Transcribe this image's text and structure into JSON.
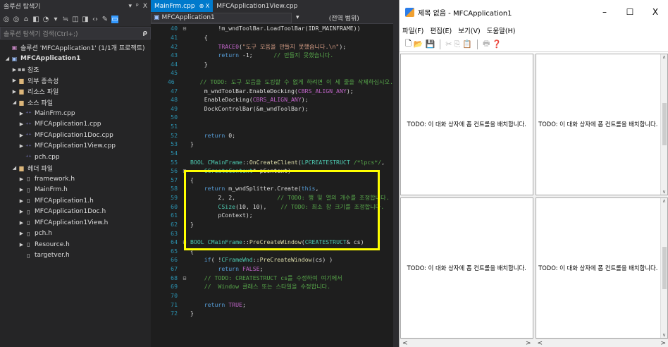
{
  "solution_explorer": {
    "title": "솔루션 탐색기",
    "title_ctrls": [
      "▾",
      "ᵖ",
      "X"
    ],
    "toolbar_icons": [
      "◎",
      "◎",
      "⌂",
      "◧",
      "◔",
      "▾",
      "≒",
      "◫",
      "◨",
      "‹›",
      "✎",
      "▭"
    ],
    "search_placeholder": "솔루션 탐색기 검색(Ctrl+;)",
    "search_icon": "ρ",
    "tree": [
      {
        "level": 0,
        "arrow": "",
        "icon": "▣",
        "icon_class": "ico-sol",
        "label": "솔루션 'MFCApplication1' (1/1개 프로젝트)",
        "bold": false
      },
      {
        "level": 0,
        "arrow": "◢",
        "icon": "▣",
        "icon_class": "ico-proj",
        "label": "MFCApplication1",
        "bold": true
      },
      {
        "level": 1,
        "arrow": "▶",
        "icon": "▪▪",
        "icon_class": "ico-ref",
        "label": "참조",
        "bold": false
      },
      {
        "level": 1,
        "arrow": "▶",
        "icon": "▆",
        "icon_class": "ico-folder",
        "label": "외부 종속성",
        "bold": false
      },
      {
        "level": 1,
        "arrow": "▶",
        "icon": "▆",
        "icon_class": "ico-folder",
        "label": "리소스 파일",
        "bold": false
      },
      {
        "level": 1,
        "arrow": "◢",
        "icon": "▆",
        "icon_class": "ico-folder",
        "label": "소스 파일",
        "bold": false
      },
      {
        "level": 2,
        "arrow": "▶",
        "icon": "⁺⁺",
        "icon_class": "ico-cpp",
        "label": "MainFrm.cpp",
        "bold": false
      },
      {
        "level": 2,
        "arrow": "▶",
        "icon": "⁺⁺",
        "icon_class": "ico-cpp",
        "label": "MFCApplication1.cpp",
        "bold": false
      },
      {
        "level": 2,
        "arrow": "▶",
        "icon": "⁺⁺",
        "icon_class": "ico-cpp",
        "label": "MFCApplication1Doc.cpp",
        "bold": false
      },
      {
        "level": 2,
        "arrow": "▶",
        "icon": "⁺⁺",
        "icon_class": "ico-cpp",
        "label": "MFCApplication1View.cpp",
        "bold": false
      },
      {
        "level": 2,
        "arrow": "",
        "icon": "⁺⁺",
        "icon_class": "ico-cpp",
        "label": "pch.cpp",
        "bold": false
      },
      {
        "level": 1,
        "arrow": "◢",
        "icon": "▆",
        "icon_class": "ico-folder",
        "label": "헤더 파일",
        "bold": false
      },
      {
        "level": 2,
        "arrow": "▶",
        "icon": "▯",
        "icon_class": "ico-h",
        "label": "framework.h",
        "bold": false
      },
      {
        "level": 2,
        "arrow": "▶",
        "icon": "▯",
        "icon_class": "ico-h",
        "label": "MainFrm.h",
        "bold": false
      },
      {
        "level": 2,
        "arrow": "▶",
        "icon": "▯",
        "icon_class": "ico-h",
        "label": "MFCApplication1.h",
        "bold": false
      },
      {
        "level": 2,
        "arrow": "▶",
        "icon": "▯",
        "icon_class": "ico-h",
        "label": "MFCApplication1Doc.h",
        "bold": false
      },
      {
        "level": 2,
        "arrow": "▶",
        "icon": "▯",
        "icon_class": "ico-h",
        "label": "MFCApplication1View.h",
        "bold": false
      },
      {
        "level": 2,
        "arrow": "▶",
        "icon": "▯",
        "icon_class": "ico-h",
        "label": "pch.h",
        "bold": false
      },
      {
        "level": 2,
        "arrow": "▶",
        "icon": "▯",
        "icon_class": "ico-h",
        "label": "Resource.h",
        "bold": false
      },
      {
        "level": 2,
        "arrow": "",
        "icon": "▯",
        "icon_class": "ico-h",
        "label": "targetver.h",
        "bold": false
      }
    ]
  },
  "editor": {
    "tabs": [
      {
        "label": "MainFrm.cpp",
        "pin": "⊕ X",
        "active": true
      },
      {
        "label": "MFCApplication1View.cpp",
        "pin": "",
        "active": false
      }
    ],
    "nav_project": "MFCApplication1",
    "nav_project_icon": "▣",
    "nav_scope": "(전역 범위)",
    "nav_dropdown": "▾",
    "lines": [
      {
        "n": "40",
        "g": "⊟",
        "h": "<span class=\"tx\">        !m_wndToolBar.LoadToolBar(IDR_MAINFRAME))</span>"
      },
      {
        "n": "41",
        "g": "",
        "h": "<span class=\"tx\">    {</span>"
      },
      {
        "n": "42",
        "g": "",
        "h": "<span class=\"tx\">        </span><span class=\"m\">TRACE0</span><span class=\"tx\">(</span><span class=\"s\">\"도구 모음을 만들지 못했습니다.\\n\"</span><span class=\"tx\">);</span>"
      },
      {
        "n": "43",
        "g": "",
        "h": "<span class=\"tx\">        </span><span class=\"k\">return</span><span class=\"tx\"> -1;      </span><span class=\"c\">// 만들지 못했습니다.</span>"
      },
      {
        "n": "44",
        "g": "",
        "h": "<span class=\"tx\">    }</span>"
      },
      {
        "n": "45",
        "g": "",
        "h": ""
      },
      {
        "n": "46",
        "g": "",
        "h": "<span class=\"tx\">    </span><span class=\"c\">// TODO: 도구 모음을 도킹할 수 없게 하려면 이 세 줄을 삭제하십시오.</span>"
      },
      {
        "n": "47",
        "g": "",
        "h": "<span class=\"tx\">    m_wndToolBar.EnableDocking(</span><span class=\"m\">CBRS_ALIGN_ANY</span><span class=\"tx\">);</span>"
      },
      {
        "n": "48",
        "g": "",
        "h": "<span class=\"tx\">    EnableDocking(</span><span class=\"m\">CBRS_ALIGN_ANY</span><span class=\"tx\">);</span>"
      },
      {
        "n": "49",
        "g": "",
        "h": "<span class=\"tx\">    DockControlBar(&amp;m_wndToolBar);</span>"
      },
      {
        "n": "50",
        "g": "",
        "h": ""
      },
      {
        "n": "51",
        "g": "",
        "h": ""
      },
      {
        "n": "52",
        "g": "",
        "h": "<span class=\"tx\">    </span><span class=\"k\">return</span><span class=\"tx\"> 0;</span>"
      },
      {
        "n": "53",
        "g": "",
        "h": "<span class=\"tx\">}</span>"
      },
      {
        "n": "54",
        "g": "",
        "h": ""
      },
      {
        "n": "55",
        "g": "",
        "h": "<span class=\"t\">BOOL</span><span class=\"tx\"> </span><span class=\"t\">CMainFrame</span><span class=\"tx\">::</span><span class=\"f\">OnCreateClient</span><span class=\"tx\">(</span><span class=\"t\">LPCREATESTRUCT</span><span class=\"tx\"> </span><span class=\"c\">/*lpcs*/</span><span class=\"tx\">,</span>"
      },
      {
        "n": "56",
        "g": "⊟",
        "h": "<span class=\"tx\">    </span><span class=\"t\">CCreateContext</span><span class=\"tx\">* pContext)</span>"
      },
      {
        "n": "57",
        "g": "",
        "h": "<span class=\"tx\">{</span>"
      },
      {
        "n": "58",
        "g": "",
        "h": "<span class=\"tx\">    </span><span class=\"k\">return</span><span class=\"tx\"> m_wndSplitter.Create(</span><span class=\"k\">this</span><span class=\"tx\">,</span>"
      },
      {
        "n": "59",
        "g": "",
        "h": "<span class=\"tx\">        2, 2,            </span><span class=\"c\">// TODO: 행 및 열의 개수를 조정합니다.</span>"
      },
      {
        "n": "60",
        "g": "",
        "h": "<span class=\"tx\">        </span><span class=\"t\">CSize</span><span class=\"tx\">(10, 10),    </span><span class=\"c\">// TODO: 최소 창 크기를 조정합니다.</span>"
      },
      {
        "n": "61",
        "g": "",
        "h": "<span class=\"tx\">        pContext);</span>"
      },
      {
        "n": "62",
        "g": "",
        "h": "<span class=\"tx\">}</span>"
      },
      {
        "n": "63",
        "g": "",
        "h": ""
      },
      {
        "n": "64",
        "g": "⊟",
        "h": "<span class=\"t\">BOOL</span><span class=\"tx\"> </span><span class=\"t\">CMainFrame</span><span class=\"tx\">::</span><span class=\"f\">PreCreateWindow</span><span class=\"tx\">(</span><span class=\"t\">CREATESTRUCT</span><span class=\"tx\">&amp; cs)</span>"
      },
      {
        "n": "65",
        "g": "",
        "h": "<span class=\"tx\">{</span>"
      },
      {
        "n": "66",
        "g": "",
        "h": "<span class=\"tx\">    </span><span class=\"k\">if</span><span class=\"tx\">( !</span><span class=\"t\">CFrameWnd</span><span class=\"tx\">::</span><span class=\"f\">PreCreateWindow</span><span class=\"tx\">(cs) )</span>"
      },
      {
        "n": "67",
        "g": "",
        "h": "<span class=\"tx\">        </span><span class=\"k\">return</span><span class=\"tx\"> </span><span class=\"m\">FALSE</span><span class=\"tx\">;</span>"
      },
      {
        "n": "68",
        "g": "⊟",
        "h": "<span class=\"tx\">    </span><span class=\"c\">// TODO: CREATESTRUCT cs를 수정하여 여기에서</span>"
      },
      {
        "n": "69",
        "g": "",
        "h": "<span class=\"tx\">    </span><span class=\"c\">//  Window 클래스 또는 스타일을 수정합니다.</span>"
      },
      {
        "n": "70",
        "g": "",
        "h": ""
      },
      {
        "n": "71",
        "g": "",
        "h": "<span class=\"tx\">    </span><span class=\"k\">return</span><span class=\"tx\"> </span><span class=\"m\">TRUE</span><span class=\"tx\">;</span>"
      },
      {
        "n": "72",
        "g": "",
        "h": "<span class=\"tx\">}</span>"
      }
    ]
  },
  "app": {
    "title": "제목 없음 - MFCApplication1",
    "win_buttons": [
      "–",
      "☐",
      "X"
    ],
    "menu": [
      "파일(F)",
      "편집(E)",
      "보기(V)",
      "도움말(H)"
    ],
    "toolbar": [
      {
        "icon": "🗋",
        "name": "new-file-icon",
        "dim": false
      },
      {
        "icon": "📂",
        "name": "open-folder-icon",
        "dim": false
      },
      {
        "icon": "💾",
        "name": "save-icon",
        "dim": false
      },
      {
        "icon": "|",
        "name": "sep",
        "dim": false
      },
      {
        "icon": "✂",
        "name": "cut-icon",
        "dim": true
      },
      {
        "icon": "⎘",
        "name": "copy-icon",
        "dim": true
      },
      {
        "icon": "📋",
        "name": "paste-icon",
        "dim": true
      },
      {
        "icon": "|",
        "name": "sep",
        "dim": false
      },
      {
        "icon": "🖶",
        "name": "print-icon",
        "dim": true
      },
      {
        "icon": "❓",
        "name": "help-icon",
        "dim": false
      }
    ],
    "pane_text": "TODO: 이 대화 상자에 폼 컨트롤을 배치합니다.",
    "scroll_up": "∧",
    "scroll_down": "∨",
    "scroll_left": "<",
    "scroll_right": ">"
  }
}
